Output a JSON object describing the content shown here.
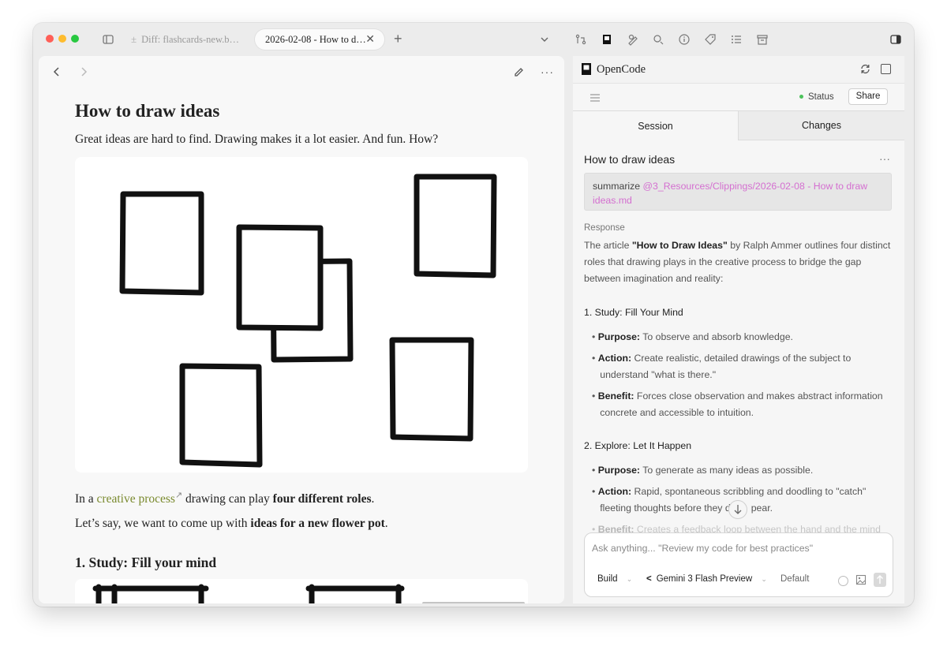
{
  "tabs": [
    {
      "label": "Diff: flashcards-new.b…",
      "icon": "plus-minus-icon"
    },
    {
      "label": "2026-02-08 - How to d…",
      "icon": "close-icon"
    }
  ],
  "new_tab_icon": "plus-icon",
  "colors": {
    "accent_link": "#7a8a2e",
    "mention": "#d46fd0",
    "status_dot": "#4cc25b",
    "close": "#ff5f57",
    "minimize": "#febc2e",
    "maximize": "#28c840"
  },
  "note": {
    "title": "How to draw ideas",
    "intro": "Great ideas are hard to find. Drawing makes it a lot easier. And fun. How?",
    "p1_pre": "In a ",
    "p1_link": "creative process",
    "p1_mid": " drawing can play ",
    "p1_bold": "four different roles",
    "p1_post": ".",
    "p2_pre": "Let’s say, we want to come up with ",
    "p2_bold": "ideas for a new flower pot",
    "p2_post": ".",
    "section_heading": "1. Study: Fill your mind"
  },
  "panel": {
    "title": "OpenCode",
    "status_label": "Status",
    "share_label": "Share",
    "tab_session": "Session",
    "tab_changes": "Changes",
    "session_title": "How to draw ideas",
    "more_label": "···",
    "prompt_prefix": "summarize ",
    "prompt_mention": "@3_Resources/Clippings/2026-02-08 - How to draw",
    "prompt_mention_2": "ideas.md",
    "response_label": "Response",
    "response_pre": "The article ",
    "response_bold": "\"How to Draw Ideas\"",
    "response_post": " by Ralph Ammer outlines four distinct",
    "response_line2": "roles that drawing plays in the creative process to bridge the gap",
    "response_line3": "between imagination and reality:",
    "section1": "1. Study: Fill Your Mind",
    "s1_purpose_k": "Purpose:",
    "s1_purpose_v": " To observe and absorb knowledge.",
    "s1_action_k": "Action:",
    "s1_action_v": " Create realistic, detailed drawings of the subject to",
    "s1_action_v2": "understand \"what is there.\"",
    "s1_benefit_k": "Benefit:",
    "s1_benefit_v": " Forces close observation and makes abstract information",
    "s1_benefit_v2": "concrete and accessible to intuition.",
    "section2": "2. Explore: Let It Happen",
    "s2_purpose_k": "Purpose:",
    "s2_purpose_v": " To generate as many ideas as possible.",
    "s2_action_k": "Action:",
    "s2_action_v": " Rapid, spontaneous scribbling and doodling to \"catch\"",
    "s2_action_v2": "fleeting thoughts before they d",
    "s2_action_v2b": "pear.",
    "s2_benefit_k": "Benefit:",
    "s2_benefit_v": " Creates a feedback loop between the hand and the mind",
    "input_placeholder": "Ask anything... \"Review my code for best practices\"",
    "agent_label": "Build",
    "model_label": "Gemini 3 Flash Preview",
    "variant_label": "Default"
  }
}
